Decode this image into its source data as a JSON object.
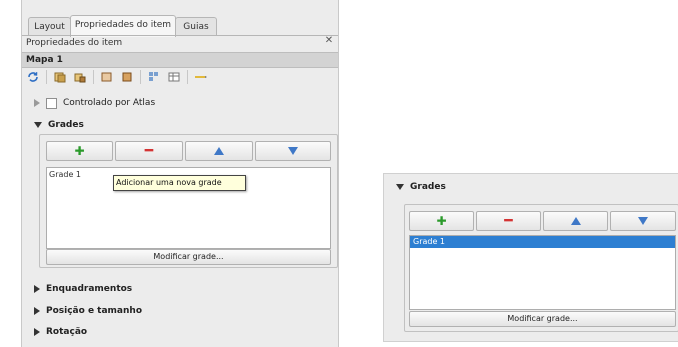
{
  "left_panel": {
    "tabs": [
      "Layout",
      "Propriedades do item",
      "Guias"
    ],
    "panel_title": "Propriedades do item",
    "section": "Mapa 1",
    "atlas_label": "Controlado por Atlas",
    "grids_label": "Grades",
    "tooltip": "Adicionar uma nova grade",
    "grid_item": "Grade 1",
    "modify_label": "Modificar grade...",
    "collapsed": [
      "Enquadramentos",
      "Posição e tamanho",
      "Rotação"
    ]
  },
  "right_panel": {
    "grids_label": "Grades",
    "grid_item": "Grade 1",
    "modify_label": "Modificar grade..."
  },
  "icons": {
    "refresh": "refresh-icon",
    "lock_layers": "lock-layers-icon",
    "style": "style-icon",
    "add": "plus-icon",
    "remove": "minus-icon",
    "up": "arrow-up-icon",
    "down": "arrow-down-icon"
  },
  "colors": {
    "selection": "#2d7fd2",
    "tooltip_bg": "#ffffdc",
    "add_icon": "#2b9a2b",
    "remove_icon": "#d43333",
    "arrow_icon": "#3f78c7"
  }
}
